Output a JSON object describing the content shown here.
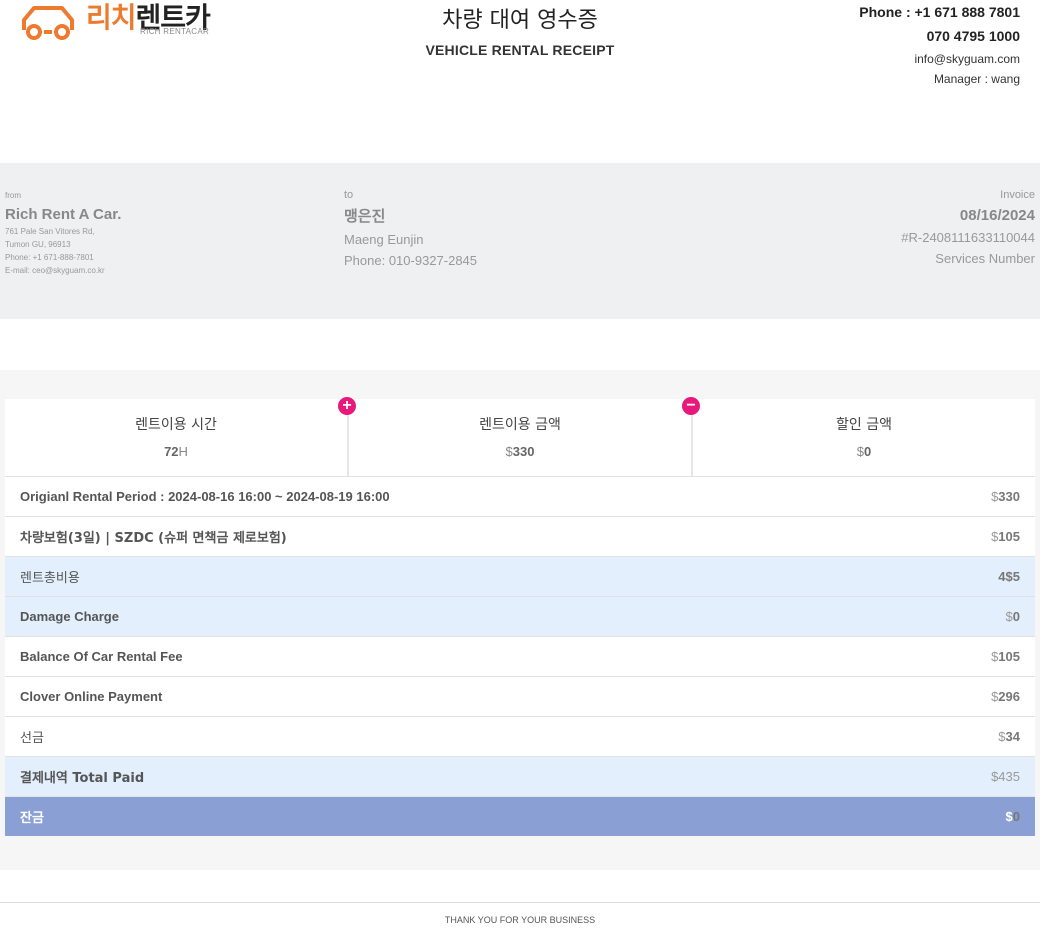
{
  "logo": {
    "name_ko_accent": "리치",
    "name_ko_dark": "렌트카",
    "name_en": "RICH RENTACAR",
    "color": "#ee7a2e"
  },
  "title": {
    "ko": "차량 대여 영수증",
    "en": "VEHICLE RENTAL RECEIPT"
  },
  "contact": {
    "phone1": "Phone : +1 671 888 7801",
    "phone2": "070 4795 1000",
    "email": "info@skyguam.com",
    "manager": "Manager : wang"
  },
  "from": {
    "label": "from",
    "name": "Rich Rent A Car.",
    "address1": "761 Pale San Vitores Rd,",
    "address2": "Tumon GU, 96913",
    "phone": "Phone: +1 671-888-7801",
    "email": "E-mail: ceo@skyguam.co.kr"
  },
  "to": {
    "label": "to",
    "name_ko": "맹은진",
    "name_en": "Maeng Eunjin",
    "phone": "Phone: 010-9327-2845"
  },
  "invoice": {
    "label": "Invoice",
    "date": "08/16/2024",
    "number": "#R-2408111633110044",
    "services_label": "Services Number"
  },
  "summary": [
    {
      "label": "렌트이용 시간",
      "value_bold": "72",
      "value_suffix": "H"
    },
    {
      "label": "렌트이용 금액",
      "value_prefix": "$",
      "value_bold": "330"
    },
    {
      "label": "할인 금액",
      "value_prefix": "$",
      "value_bold": "0"
    }
  ],
  "operators": {
    "plus": "+",
    "minus": "−",
    "color": "#e8197a"
  },
  "lines": [
    {
      "label": "Origianl Rental Period : 2024-08-16 16:00 ~ 2024-08-19 16:00",
      "value_prefix": "$",
      "value_bold": "330",
      "style": "white"
    },
    {
      "label": "차량보험(3일) | SZDC (슈퍼 면책금 제로보험)",
      "value_prefix": "$",
      "value_bold": "105",
      "style": "white"
    },
    {
      "label": "렌트총비용",
      "value_prefix": "",
      "value_bold": "4$5",
      "style": "blue"
    },
    {
      "label": "Damage Charge",
      "value_prefix": "$",
      "value_bold": "0",
      "style": "blue"
    },
    {
      "label": "Balance Of Car Rental Fee",
      "value_prefix": "$",
      "value_bold": "105",
      "style": "white"
    },
    {
      "label": "Clover Online Payment",
      "value_prefix": "$",
      "value_bold": "296",
      "style": "white"
    },
    {
      "label": "선금",
      "value_prefix": "$",
      "value_bold": "34",
      "style": "white"
    },
    {
      "label": "결제내역 Total Paid",
      "value_prefix": "$435",
      "value_bold": "",
      "style": "blue"
    },
    {
      "label": "잔금",
      "value_prefix": "$",
      "value_bold": "0",
      "style": "total"
    }
  ],
  "footer": "THANK YOU FOR YOUR BUSINESS",
  "colors": {
    "info_band": "#eef0f1",
    "highlight_row": "#e3effd",
    "total_row": "#8a9fd4"
  }
}
